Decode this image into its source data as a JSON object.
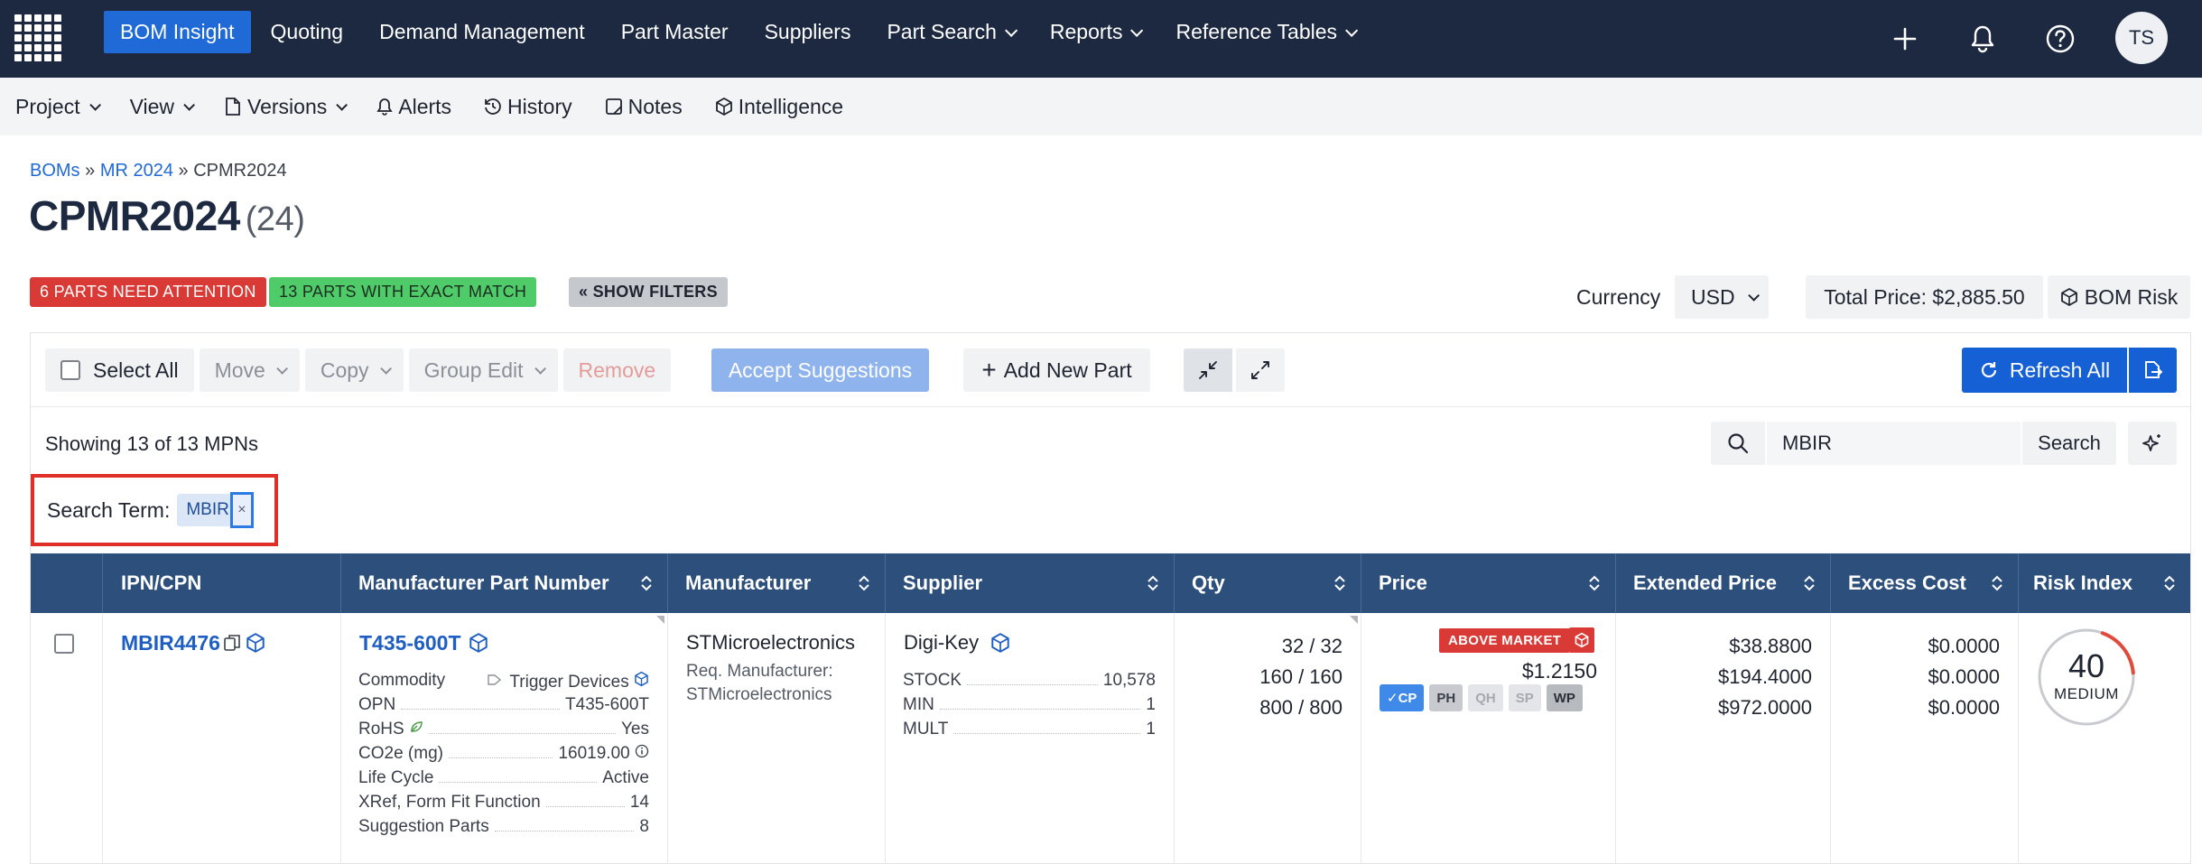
{
  "topnav": {
    "items": [
      {
        "label": "BOM Insight",
        "active": true,
        "caret": false
      },
      {
        "label": "Quoting",
        "active": false,
        "caret": false
      },
      {
        "label": "Demand Management",
        "active": false,
        "caret": false
      },
      {
        "label": "Part Master",
        "active": false,
        "caret": false
      },
      {
        "label": "Suppliers",
        "active": false,
        "caret": false
      },
      {
        "label": "Part Search",
        "active": false,
        "caret": true
      },
      {
        "label": "Reports",
        "active": false,
        "caret": true
      },
      {
        "label": "Reference Tables",
        "active": false,
        "caret": true
      }
    ],
    "avatar_initials": "TS",
    "icons": [
      "app-grid-icon",
      "plus-icon",
      "bell-icon",
      "help-icon"
    ]
  },
  "subnav": {
    "project": "Project",
    "view": "View",
    "versions": "Versions",
    "alerts": "Alerts",
    "history": "History",
    "notes": "Notes",
    "intelligence": "Intelligence"
  },
  "breadcrumb": {
    "level1": "BOMs",
    "level2": "MR 2024",
    "current": "CPMR2024",
    "separator": "»"
  },
  "page": {
    "title": "CPMR2024",
    "count": "(24)"
  },
  "badges": {
    "attention": "6 PARTS NEED ATTENTION",
    "exact_match": "13 PARTS WITH EXACT MATCH",
    "show_filters": "« SHOW FILTERS"
  },
  "summary": {
    "currency_label": "Currency",
    "currency_value": "USD",
    "total_price": "Total Price: $2,885.50",
    "bom_risk": "BOM Risk"
  },
  "toolbar": {
    "select_all": "Select All",
    "move": "Move",
    "copy": "Copy",
    "group_edit": "Group Edit",
    "remove": "Remove",
    "accept_suggestions": "Accept Suggestions",
    "add_new_part": "Add New Part",
    "refresh_all": "Refresh All"
  },
  "search": {
    "showing": "Showing 13 of 13 MPNs",
    "value": "MBIR",
    "button": "Search",
    "term_label": "Search Term:",
    "term_chip": "MBIR",
    "chip_close": "×"
  },
  "table": {
    "columns": [
      "IPN/CPN",
      "Manufacturer Part Number",
      "Manufacturer",
      "Supplier",
      "Qty",
      "Price",
      "Extended Price",
      "Excess Cost",
      "Risk Index"
    ],
    "rows": [
      {
        "ipn": "MBIR4476",
        "mpn": "T435-600T",
        "attrs": {
          "commodity_label": "Commodity",
          "commodity_value": "Trigger Devices",
          "opn_label": "OPN",
          "opn_value": "T435-600T",
          "rohs_label": "RoHS",
          "rohs_value": "Yes",
          "co2_label": "CO2e (mg)",
          "co2_value": "16019.00",
          "lifecycle_label": "Life Cycle",
          "lifecycle_value": "Active",
          "xref_label": "XRef, Form Fit Function",
          "xref_value": "14",
          "suggest_label": "Suggestion Parts",
          "suggest_value": "8"
        },
        "manufacturer": "STMicroelectronics",
        "req_manufacturer_label": "Req. Manufacturer:",
        "req_manufacturer": "STMicroelectronics",
        "supplier": "Digi-Key",
        "stock_label": "STOCK",
        "stock_value": "10,578",
        "min_label": "MIN",
        "min_value": "1",
        "mult_label": "MULT",
        "mult_value": "1",
        "qty": [
          "32 / 32",
          "160 / 160",
          "800 / 800"
        ],
        "price_badge": "ABOVE MARKET",
        "price": "$1.2150",
        "price_chips": [
          "✓CP",
          "PH",
          "QH",
          "SP",
          "WP"
        ],
        "extended": [
          "$38.8800",
          "$194.4000",
          "$972.0000"
        ],
        "excess": [
          "$0.0000",
          "$0.0000",
          "$0.0000"
        ],
        "risk_score": "40",
        "risk_level": "MEDIUM",
        "risk_fraction": 0.4
      }
    ]
  },
  "colors": {
    "nav_bg": "#1c2940",
    "accent": "#1f6ad6",
    "table_header": "#2c4f7c",
    "danger": "#d93a36",
    "success": "#4fcb6a"
  }
}
